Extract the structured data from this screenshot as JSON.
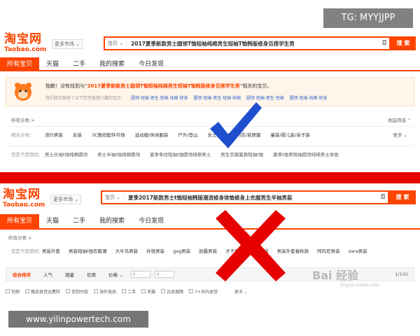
{
  "overlays": {
    "top_badge": "TG: MYYJJPP",
    "bottom_badge": "www.yilinpowertech.com",
    "baidu_watermark": "Bai 经验",
    "baidu_sub": "jingyan.baidu.com"
  },
  "top": {
    "logo_cn": "淘宝网",
    "logo_en": "Taobao.com",
    "more_market": "更多市场 ⌄",
    "search_scope": "宝贝 ⌄",
    "search_query": "2017夏季新款男士圆领T恤短袖纯棉男生短袖T恤韩版修身百搭学生男",
    "search_button": "搜 索",
    "tabs": [
      "所有宝贝",
      "天猫",
      "二手",
      "我的搜索",
      "今日发现"
    ],
    "notice_prefix": "抱歉！没有找到与“",
    "notice_query": "2017夏季新款男士圆领T恤短袖纯棉男生短袖T恤韩版修身百搭学生男",
    "notice_suffix": "”相关的宝贝。",
    "notice_hint": "我们给您推荐了以下您可能感兴趣的宝贝：",
    "notice_suggestions": [
      "圆领 短袖 男生 短袖 纯棉 修身",
      "圆领 短袖 男生 短袖 纯棉",
      "圆领 短袖 男生 短袖",
      "圆领 短袖 纯棉 修身"
    ],
    "filter_title": "所有分类 >",
    "fold_toggle": "收起筛选 ⌃",
    "category_label": "相关分类：",
    "categories": [
      "流行男装",
      "女装",
      "3C数码配件市场",
      "运动服/休闲服装",
      "户外/登山",
      "女士内衣/男士内衣/家居服",
      "童装/婴儿装/亲子装"
    ],
    "category_more": "更多 ⌄",
    "related_label": "您是不是想找：",
    "related": [
      "男士长袖t恤纯棉圆领",
      "男士半袖t恤纯棉圆领",
      "夏季条纹短袖t恤圆领纯棉男士",
      "男生衣服夏款短袖t恤",
      "夏季t恤男短袖圆领纯棉男士体恤"
    ]
  },
  "bottom": {
    "logo_cn": "淘宝网",
    "logo_en": "Taobao.com",
    "more_market": "更多市场 ⌄",
    "search_scope": "宝贝 ⌄",
    "search_query": "夏季2017新款男士t恤短袖韩版潮流修身体恤修身上衣服男生半袖男装",
    "search_button": "搜 索",
    "tabs": [
      "所有宝贝",
      "天猫",
      "二手",
      "我的搜索",
      "今日发现"
    ],
    "filter_title": "所有分类 >",
    "suggest_label": "您是不是想找：",
    "suggestions": [
      "男装外套",
      "男装短袖t恤衣服潮",
      "大牛鸟男装",
      "孙悦男装",
      "gxg男装",
      "劲霸男装",
      "才子男装",
      "hm男装",
      "男装外套春秋款",
      "阿玛尼男装",
      "zara男装"
    ],
    "sort_items": [
      "综合排序",
      "人气",
      "销量",
      "信用",
      "价格 ⌄"
    ],
    "price_from": "¥",
    "price_to": "¥",
    "page_info": "1/100",
    "checkboxes": [
      "包邮",
      "赠送退货运费险",
      "货到付款",
      "海外商品",
      "二手",
      "天猫",
      "正品保障",
      "7+天内退货"
    ],
    "check_more": "更多 ⌄"
  },
  "colors": {
    "brand": "#ff4400",
    "divider": "#e60000",
    "tick": "#1f4ecf",
    "cross": "#e60000"
  }
}
